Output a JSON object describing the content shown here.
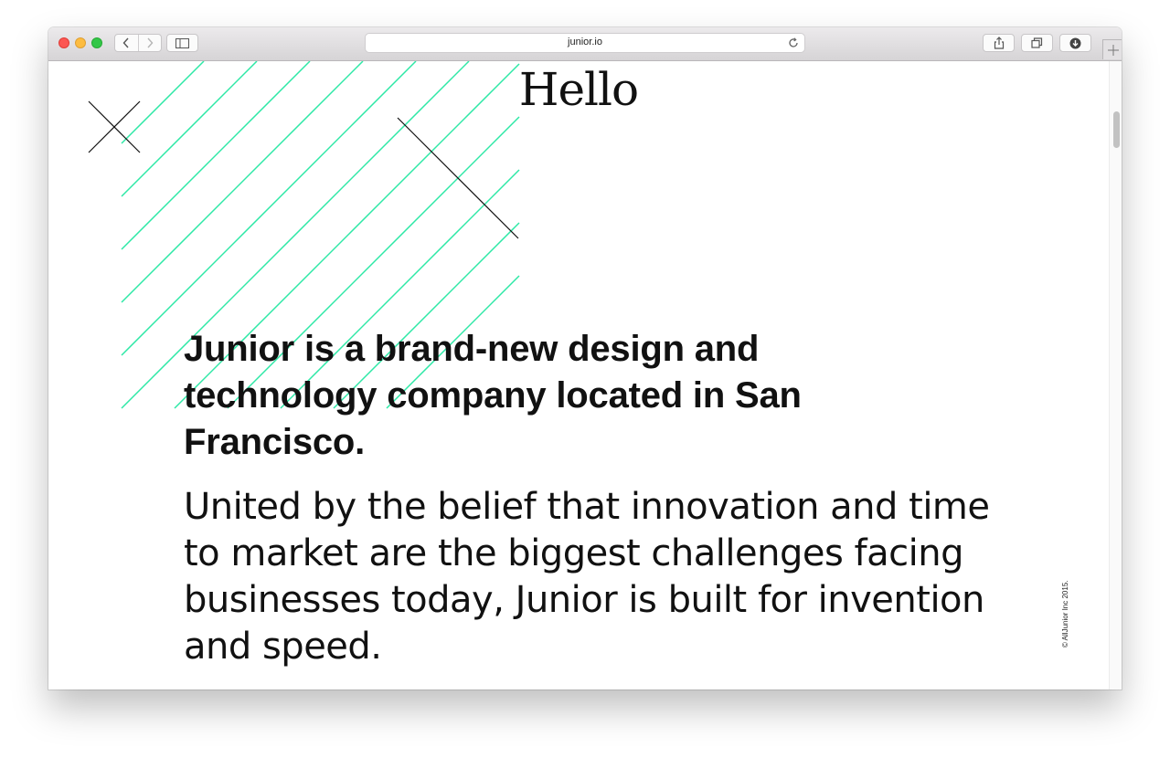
{
  "browser": {
    "url": "junior.io"
  },
  "page": {
    "title": "Hello",
    "headline": "Junior is a brand-new design and technology company located in San Francisco.",
    "body": "United by the belief that innovation and time to market are the biggest challenges facing businesses today, Junior is built for invention and speed.",
    "copyright": "© AllJunior Inc 2015."
  },
  "colors": {
    "accent_stripes": "#2ee8a6",
    "text": "#111111"
  },
  "icons": [
    "back-arrow-icon",
    "forward-arrow-icon",
    "sidebar-icon",
    "reload-icon",
    "share-icon",
    "tabs-icon",
    "download-icon",
    "plus-icon",
    "close-x-icon"
  ]
}
